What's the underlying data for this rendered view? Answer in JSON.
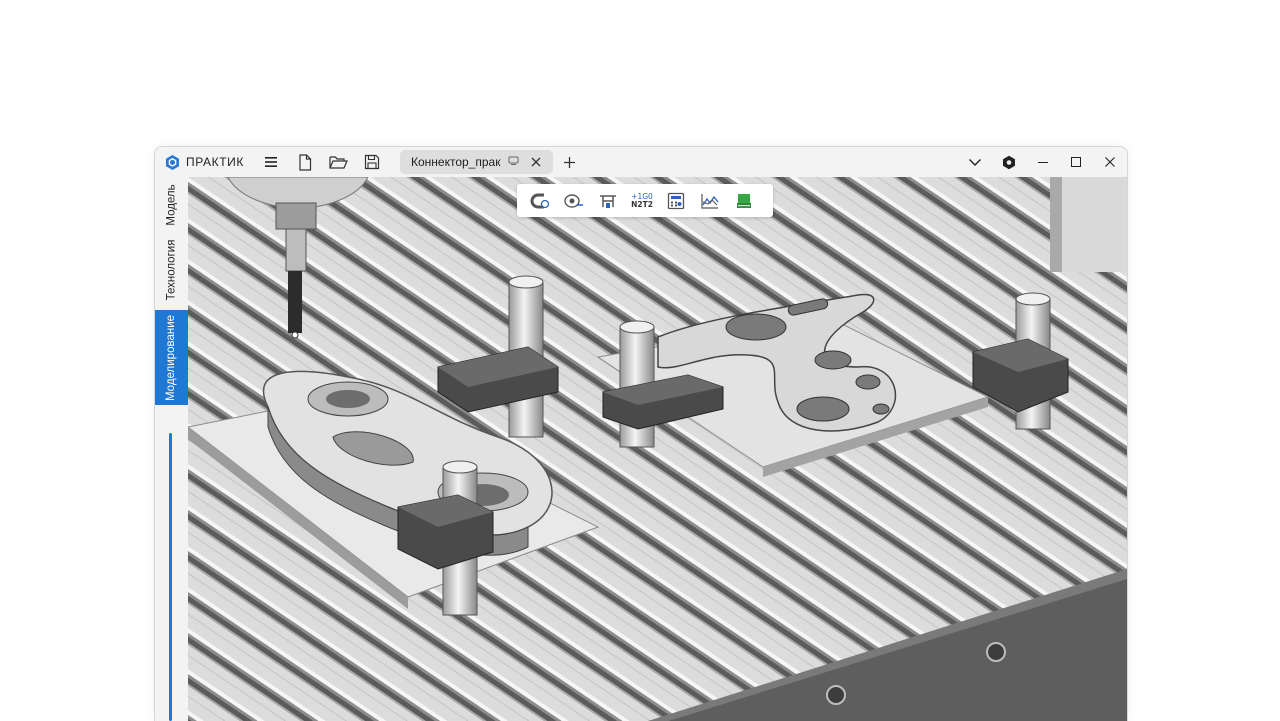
{
  "app": {
    "name": "ПРАКТИК"
  },
  "tabs": [
    {
      "title": "Коннектор_практик"
    }
  ],
  "sidebar": {
    "items": [
      {
        "label": "Модель"
      },
      {
        "label": "Технология"
      },
      {
        "label": "Моделирование",
        "active": true
      }
    ]
  },
  "toolbar": {
    "items": [
      {
        "icon": "magnet-icon"
      },
      {
        "icon": "measure-icon"
      },
      {
        "icon": "caliper-icon"
      },
      {
        "icon": "gcode-icon",
        "text_top": "+1G0",
        "text_bottom": "N2T2"
      },
      {
        "icon": "calculator-icon"
      },
      {
        "icon": "graph-icon"
      },
      {
        "icon": "stock-icon"
      }
    ]
  },
  "colors": {
    "accent": "#1e78d4",
    "stock_icon": "#35a845"
  }
}
